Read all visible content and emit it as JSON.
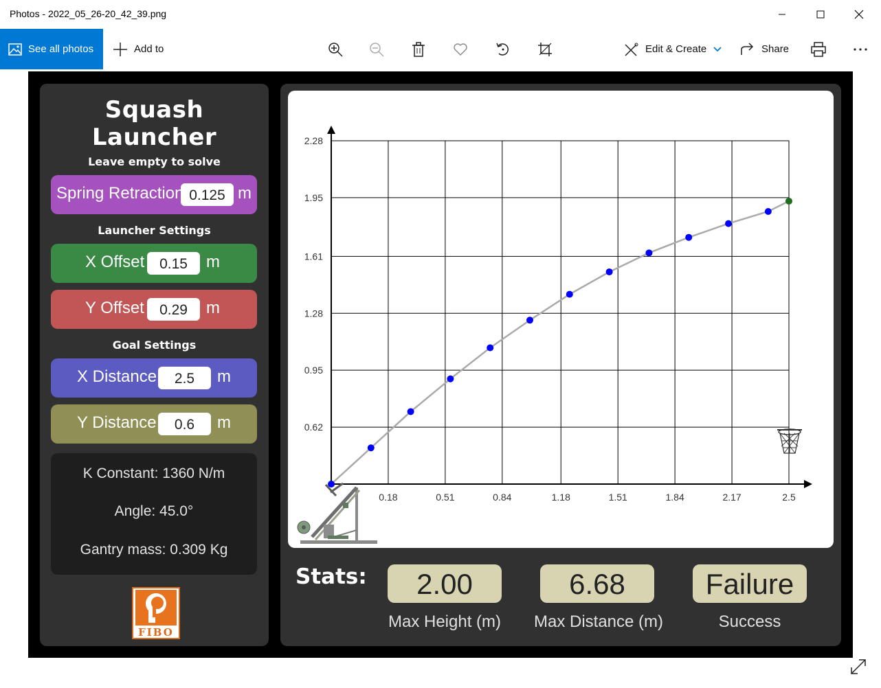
{
  "window": {
    "title": "Photos - 2022_05_26-20_42_39.png"
  },
  "toolbar": {
    "see_all": "See all photos",
    "add_to": "Add to",
    "edit_create": "Edit & Create",
    "share": "Share",
    "icons": [
      "zoom-in-icon",
      "zoom-out-icon",
      "delete-icon",
      "favorite-icon",
      "rotate-icon",
      "crop-icon",
      "print-icon",
      "more-icon"
    ]
  },
  "app": {
    "title": "Squash Launcher",
    "solve_hint": "Leave empty to solve",
    "spring": {
      "label": "Spring Retraction",
      "value": "0.125",
      "unit": "m"
    },
    "launcher_settings": "Launcher Settings",
    "x_offset": {
      "label": "X Offset",
      "value": "0.15",
      "unit": "m"
    },
    "y_offset": {
      "label": "Y Offset",
      "value": "0.29",
      "unit": "m"
    },
    "goal_settings": "Goal Settings",
    "x_distance": {
      "label": "X Distance",
      "value": "2.5",
      "unit": "m"
    },
    "y_distance": {
      "label": "Y Distance",
      "value": "0.6",
      "unit": "m"
    },
    "info": {
      "k_constant": "K Constant: 1360 N/m",
      "angle": "Angle: 45.0°",
      "gantry_mass": "Gantry mass: 0.309 Kg"
    },
    "logo_text": "FIBO",
    "stats": {
      "label": "Stats:",
      "max_height": {
        "value": "2.00",
        "caption": "Max Height (m)"
      },
      "max_distance": {
        "value": "6.68",
        "caption": "Max Distance (m)"
      },
      "success": {
        "value": "Failure",
        "caption": "Success"
      }
    }
  },
  "colors": {
    "spring": "#a552be",
    "x_offset": "#3a8a46",
    "y_offset": "#c25656",
    "x_distance": "#5b5bc2",
    "y_distance": "#8f8f56",
    "trajectory_point": "#0000ff",
    "target_point": "#1f6e1f",
    "accent": "#0078d4"
  },
  "chart_data": {
    "type": "scatter",
    "x_ticks": [
      "0.18",
      "0.51",
      "0.84",
      "1.18",
      "1.51",
      "1.84",
      "2.17",
      "2.5"
    ],
    "y_ticks": [
      "0.62",
      "0.95",
      "1.28",
      "1.61",
      "1.95",
      "2.28"
    ],
    "xlim": [
      -0.15,
      2.5
    ],
    "ylim": [
      0.29,
      2.28
    ],
    "grid": true,
    "series": [
      {
        "x": [
          -0.15,
          0.08,
          0.31,
          0.54,
          0.77,
          1.0,
          1.23,
          1.46,
          1.69,
          1.92,
          2.15,
          2.38
        ],
        "y": [
          0.29,
          0.5,
          0.71,
          0.9,
          1.08,
          1.24,
          1.39,
          1.52,
          1.63,
          1.72,
          1.8,
          1.87
        ]
      }
    ],
    "target": {
      "x": 2.5,
      "y": 1.93
    },
    "curve": {
      "x": [
        -0.15,
        0.08,
        0.31,
        0.54,
        0.77,
        1.0,
        1.23,
        1.46,
        1.69,
        1.92,
        2.15,
        2.38,
        2.5
      ],
      "y": [
        0.29,
        0.5,
        0.71,
        0.9,
        1.08,
        1.24,
        1.39,
        1.52,
        1.63,
        1.72,
        1.8,
        1.87,
        1.93
      ]
    }
  }
}
